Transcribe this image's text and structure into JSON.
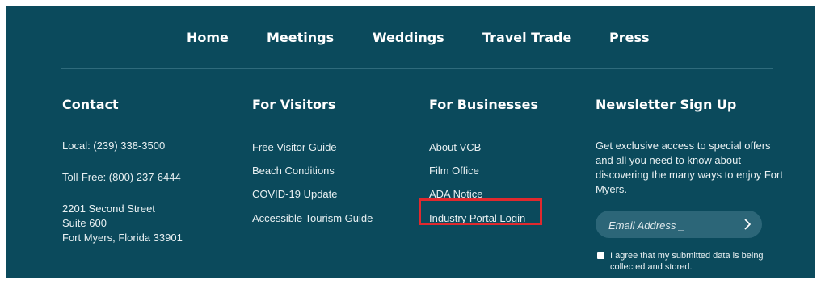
{
  "nav": {
    "items": [
      "Home",
      "Meetings",
      "Weddings",
      "Travel Trade",
      "Press"
    ]
  },
  "contact": {
    "heading": "Contact",
    "local": "Local: (239) 338-3500",
    "tollfree": "Toll-Free: (800) 237-6444",
    "address": [
      "2201 Second Street",
      "Suite 600",
      "Fort Myers, Florida 33901"
    ]
  },
  "visitors": {
    "heading": "For Visitors",
    "links": [
      "Free Visitor Guide",
      "Beach Conditions",
      "COVID-19 Update",
      "Accessible Tourism Guide"
    ]
  },
  "businesses": {
    "heading": "For Businesses",
    "links": [
      "About VCB",
      "Film Office",
      "ADA Notice",
      "Industry Portal Login"
    ]
  },
  "newsletter": {
    "heading": "Newsletter Sign Up",
    "text": "Get exclusive access to special offers and all you need to know about discovering the many ways to enjoy Fort Myers.",
    "email_placeholder": "Email Address _",
    "email_value": "",
    "submit_icon": "chevron-right-icon",
    "agree_text": "I agree that my submitted data is being collected and stored."
  },
  "colors": {
    "background": "#0b4a5c",
    "highlight_border": "#e0292e",
    "input_fill": "#2c6678"
  }
}
